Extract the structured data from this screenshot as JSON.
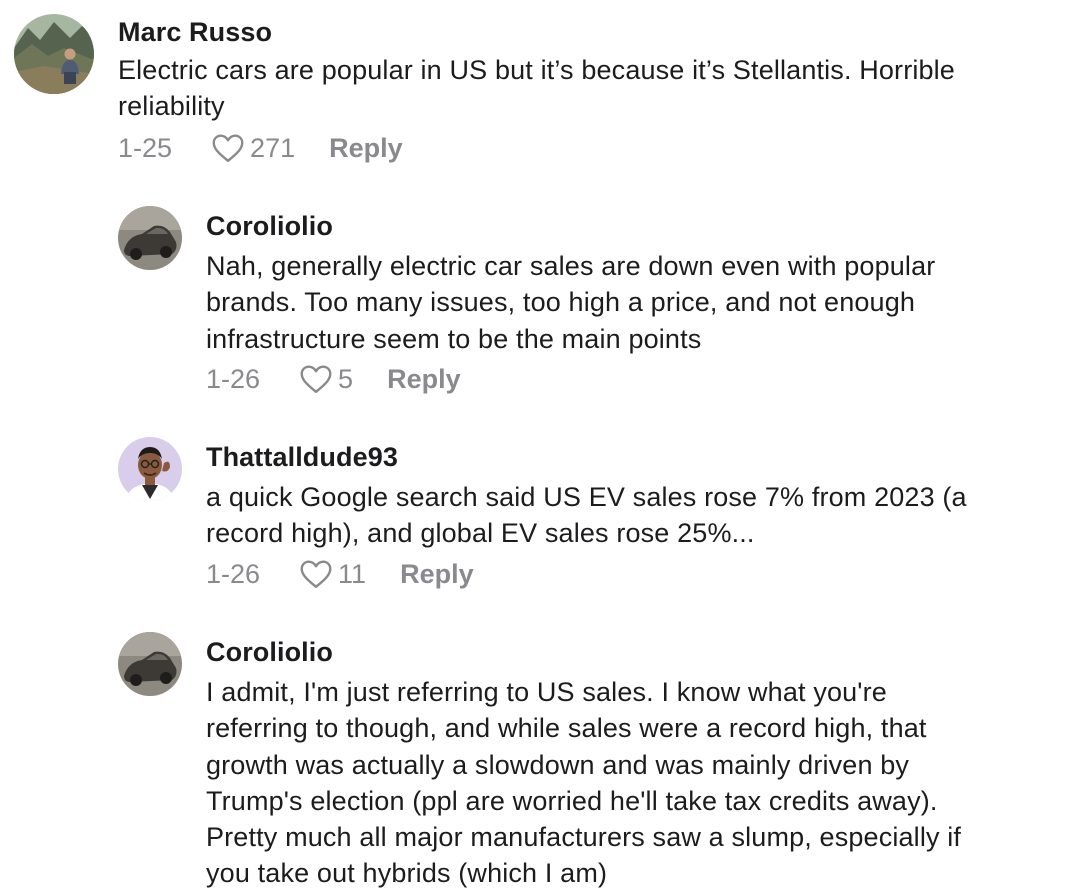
{
  "comments": [
    {
      "username": "Marc Russo",
      "text": "Electric cars are popular in US but it’s because it’s Stellantis. Horrible\nreliability",
      "date": "1-25",
      "likes": "271",
      "reply_label": "Reply",
      "avatar_icon": "avatar-mountain-photo"
    },
    {
      "username": "Coroliolio",
      "text": "Nah, generally electric car sales are down even with popular\nbrands. Too many issues, too high a price, and not enough\ninfrastructure seem to be the main points",
      "date": "1-26",
      "likes": "5",
      "reply_label": "Reply",
      "avatar_icon": "avatar-car-photo"
    },
    {
      "username": "Thattalldude93",
      "text": "a quick Google search said US EV sales rose 7% from 2023 (a\nrecord high), and global EV sales rose 25%...",
      "date": "1-26",
      "likes": "11",
      "reply_label": "Reply",
      "avatar_icon": "avatar-cartoon-man"
    },
    {
      "username": "Coroliolio",
      "text": "I admit, I'm just referring to US sales. I know what you're\nreferring to though, and while sales were a record high, that\ngrowth was actually a slowdown and was mainly driven by\nTrump's election (ppl are worried he'll take tax credits away).\nPretty much all major manufacturers saw a slump, especially if\nyou take out hybrids (which I am)",
      "avatar_icon": "avatar-car-photo"
    }
  ],
  "colors": {
    "text": "#1c1c1e",
    "meta": "#8a8a8e",
    "background": "#ffffff"
  },
  "icons": {
    "like": "heart-outline-icon"
  }
}
